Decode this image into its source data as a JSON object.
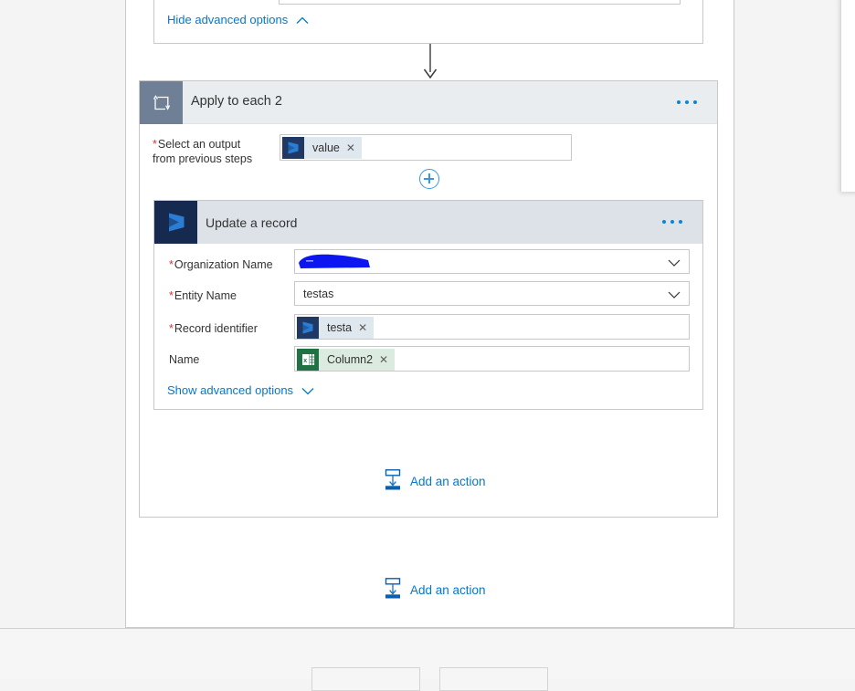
{
  "app": {
    "surface_name": "flow-designer-canvas"
  },
  "previous_card": {
    "advanced_toggle_label": "Hide advanced options",
    "advanced_toggle_icon": "chevron-up-icon",
    "input_value": ""
  },
  "connector": {
    "icon": "down-arrow-connector-icon"
  },
  "scope_card": {
    "icon": "loop-foreach-icon",
    "title": "Apply to each 2",
    "menu_icon": "ellipsis-horizontal-icon",
    "output_field": {
      "label_line1": "Select an output",
      "label_line2": "from previous steps",
      "required": true,
      "token": {
        "icon": "dynamics365-icon",
        "text": "value",
        "remove_icon": "close-icon"
      }
    },
    "add_token_button_icon": "plus-circle-icon",
    "add_action": {
      "icon": "add-an-action-icon",
      "label": "Add an action"
    }
  },
  "action_card": {
    "icon": "dynamics365-icon",
    "title": "Update a record",
    "menu_icon": "ellipsis-horizontal-icon",
    "fields": [
      {
        "name": "organization-name",
        "label": "Organization Name",
        "required": true,
        "type": "dropdown",
        "value": "",
        "redacted": true,
        "redaction_color": "#0b16f0",
        "chevron_icon": "chevron-down-icon"
      },
      {
        "name": "entity-name",
        "label": "Entity Name",
        "required": true,
        "type": "dropdown",
        "value": "testas",
        "redacted": false,
        "chevron_icon": "chevron-down-icon"
      },
      {
        "name": "record-identifier",
        "label": "Record identifier",
        "required": true,
        "type": "token",
        "token": {
          "icon": "dynamics365-icon",
          "text": "testa",
          "remove_icon": "close-icon"
        }
      },
      {
        "name": "name",
        "label": "Name",
        "required": false,
        "type": "token",
        "token": {
          "icon": "excel-icon",
          "text": "Column2",
          "remove_icon": "close-icon"
        }
      }
    ],
    "advanced_toggle_label": "Show advanced options",
    "advanced_toggle_icon": "chevron-down-icon"
  },
  "outer_add_action": {
    "icon": "add-an-action-icon",
    "label": "Add an action"
  },
  "bottom_bar": {
    "buttons": [
      {
        "name": "bottom-button-1",
        "label": ""
      },
      {
        "name": "bottom-button-2",
        "label": ""
      }
    ]
  },
  "colors": {
    "link": "#0078d4",
    "required": "#d13438",
    "scope_header": "#e9edf0",
    "scope_icon_bg": "#6f7f95",
    "action_header": "#dde2e8",
    "dynamics_bg": "#16294f",
    "excel_bg": "#207245"
  }
}
